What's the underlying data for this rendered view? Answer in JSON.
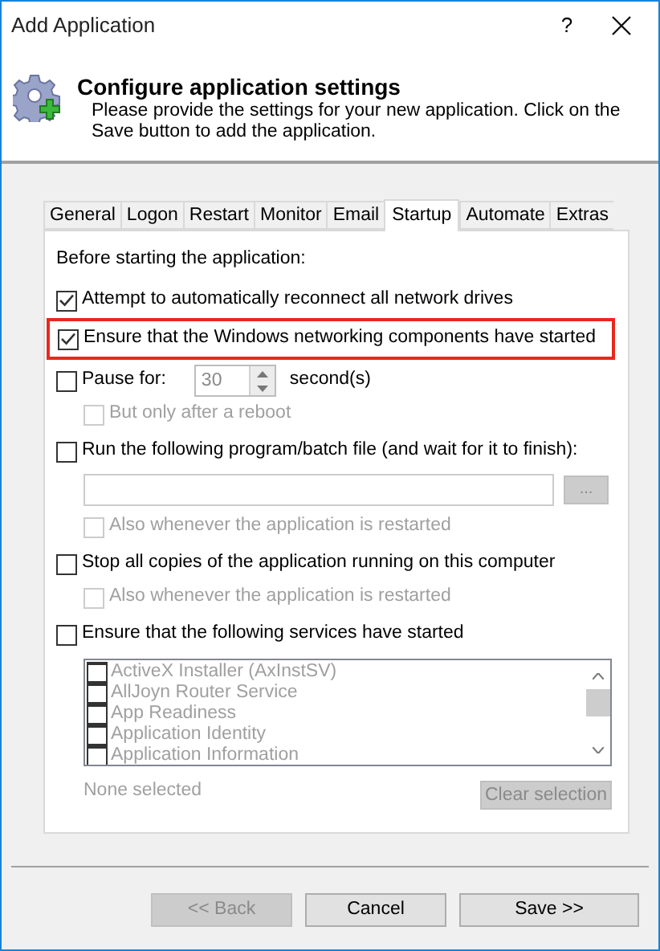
{
  "window": {
    "title": "Add Application",
    "help": "?"
  },
  "header": {
    "title": "Configure application settings",
    "description": "Please provide the settings for your new application. Click on the Save button to add the application."
  },
  "tabs": [
    {
      "label": "General",
      "selected": false
    },
    {
      "label": "Logon",
      "selected": false
    },
    {
      "label": "Restart",
      "selected": false
    },
    {
      "label": "Monitor",
      "selected": false
    },
    {
      "label": "Email",
      "selected": false
    },
    {
      "label": "Startup",
      "selected": true
    },
    {
      "label": "Automate",
      "selected": false
    },
    {
      "label": "Extras",
      "selected": false
    }
  ],
  "options": [
    {
      "kind": "heading",
      "text": "Before starting the application:"
    },
    {
      "kind": "check",
      "label": "Attempt to automatically reconnect all network drives",
      "checked": true
    },
    {
      "kind": "check",
      "label": "Ensure that the Windows networking components have started",
      "checked": true,
      "highlighted": true
    },
    {
      "kind": "spin",
      "label": "Pause for:",
      "checked": false,
      "value": "30",
      "unit": "second(s)"
    },
    {
      "kind": "sub",
      "label": "But only after a reboot",
      "checked": false,
      "disabled": true
    },
    {
      "kind": "check",
      "label": "Run the following program/batch file (and wait for it to finish):",
      "checked": false
    },
    {
      "kind": "file",
      "browse": "...",
      "disabled": true
    },
    {
      "kind": "sub",
      "label": "Also whenever the application is restarted",
      "checked": false,
      "disabled": true
    },
    {
      "kind": "check",
      "label": "Stop all copies of the application running on this computer",
      "checked": false
    },
    {
      "kind": "sub",
      "label": "Also whenever the application is restarted",
      "checked": false,
      "disabled": true
    },
    {
      "kind": "check",
      "label": "Ensure that the following services have started",
      "checked": false
    },
    {
      "kind": "services",
      "disabled": true,
      "items": [
        {
          "label": "ActiveX Installer (AxInstSV)",
          "checked": false
        },
        {
          "label": "AllJoyn Router Service",
          "checked": false
        },
        {
          "label": "App Readiness",
          "checked": false
        },
        {
          "label": "Application Identity",
          "checked": false
        },
        {
          "label": "Application Information",
          "checked": false
        }
      ],
      "status": "None selected",
      "clear": "Clear selection"
    }
  ],
  "buttons": [
    {
      "label": "<< Back",
      "disabled": true
    },
    {
      "label": "Cancel",
      "disabled": false
    },
    {
      "label": "Save >>",
      "disabled": false
    }
  ]
}
